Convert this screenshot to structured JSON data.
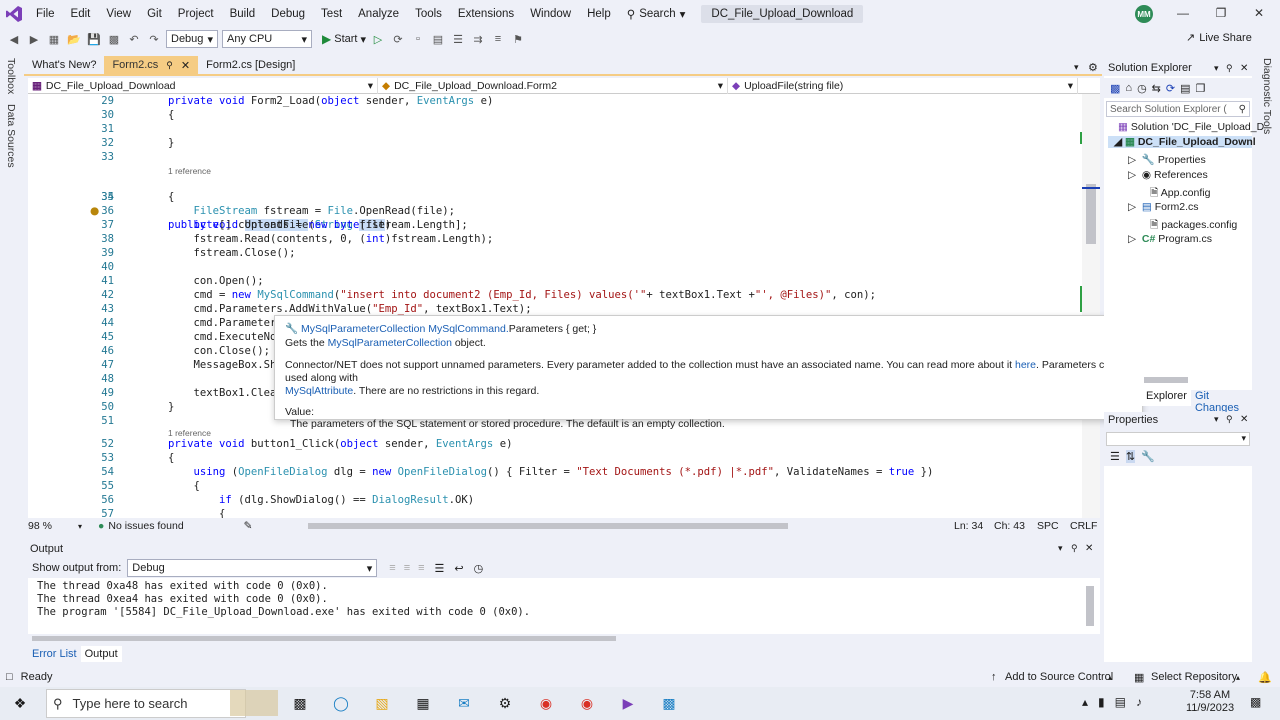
{
  "menu": [
    "File",
    "Edit",
    "View",
    "Git",
    "Project",
    "Build",
    "Debug",
    "Test",
    "Analyze",
    "Tools",
    "Extensions",
    "Window",
    "Help"
  ],
  "search_label": "Search",
  "solution_title": "DC_File_Upload_Download",
  "avatar_initials": "MM",
  "toolbar": {
    "config": "Debug",
    "platform": "Any CPU",
    "start": "Start",
    "live_share": "Live Share"
  },
  "left_strip": {
    "toolbox": "Toolbox",
    "data_sources": "Data Sources"
  },
  "right_strip": {
    "diagnostic": "Diagnostic Tools"
  },
  "tabs": [
    {
      "label": "What's New?"
    },
    {
      "label": "Form2.cs"
    },
    {
      "label": "Form2.cs [Design]"
    }
  ],
  "navbar": {
    "project": "DC_File_Upload_Download",
    "class": "DC_File_Upload_Download.Form2",
    "member": "UploadFile(string file)"
  },
  "code": [
    {
      "n": "29",
      "t": "private void Form2_Load(object sender, EventArgs e)"
    },
    {
      "n": "30",
      "t": "{"
    },
    {
      "n": "31",
      "t": ""
    },
    {
      "n": "32",
      "t": "}"
    },
    {
      "n": "33",
      "t": ""
    },
    {
      "ref": "1 reference"
    },
    {
      "n": "34",
      "t": "public void UploadFile(String file)"
    },
    {
      "n": "35",
      "t": "{"
    },
    {
      "n": "36",
      "t": "    FileStream fstream = File.OpenRead(file);"
    },
    {
      "n": "37",
      "t": "    byte[] contents = new byte[fstream.Length];"
    },
    {
      "n": "38",
      "t": "    fstream.Read(contents, 0, (int)fstream.Length);"
    },
    {
      "n": "39",
      "t": "    fstream.Close();"
    },
    {
      "n": "40",
      "t": ""
    },
    {
      "n": "41",
      "t": "    con.Open();"
    },
    {
      "n": "42",
      "t": "    cmd = new MySqlCommand(\"insert into document2 (Emp_Id, Files) values('\"+ textBox1.Text +\"', @Files)\", con);"
    },
    {
      "n": "43",
      "t": "    cmd.Parameters.AddWithValue(\"Emp_Id\", textBox1.Text);"
    },
    {
      "n": "44",
      "t": "    cmd.Parameter"
    },
    {
      "n": "45",
      "t": "    cmd.ExecuteNo"
    },
    {
      "n": "46",
      "t": "    con.Close();"
    },
    {
      "n": "47",
      "t": "    MessageBox.Sh"
    },
    {
      "n": "48",
      "t": ""
    },
    {
      "n": "49",
      "t": "    textBox1.Clea"
    },
    {
      "n": "50",
      "t": "}"
    },
    {
      "n": "51",
      "t": ""
    },
    {
      "ref": "1 reference"
    },
    {
      "n": "52",
      "t": "private void button1_Click(object sender, EventArgs e)"
    },
    {
      "n": "53",
      "t": "{"
    },
    {
      "n": "54",
      "t": "    using (OpenFileDialog dlg = new OpenFileDialog() { Filter = \"Text Documents (*.pdf) |*.pdf\", ValidateNames = true })"
    },
    {
      "n": "55",
      "t": "    {"
    },
    {
      "n": "56",
      "t": "        if (dlg.ShowDialog() == DialogResult.OK)"
    },
    {
      "n": "57",
      "t": "        {"
    }
  ],
  "tooltip": {
    "signature_prefix": "MySqlParameterCollection MySqlCommand.",
    "signature_member": "Parameters",
    "signature_suffix": " { get; }",
    "summary_prefix": "Gets the ",
    "summary_link": "MySqlParameterCollection",
    "summary_suffix": " object.",
    "remarks_1": "Connector/NET does not support unnamed parameters. Every parameter added to the collection must have an associated name. You can read more about it ",
    "remarks_link": "here",
    "remarks_2": ". Parameters can be used along with",
    "remarks_link2": "MySqlAttribute",
    "remarks_3": ". There are no restrictions in this regard.",
    "value_label": "Value:",
    "value_text": "The parameters of the SQL statement or stored procedure. The default is an empty collection."
  },
  "editor_status": {
    "zoom": "98 %",
    "issues": "No issues found",
    "ln": "Ln: 34",
    "ch": "Ch: 43",
    "spc": "SPC",
    "crlf": "CRLF"
  },
  "solution_explorer": {
    "title": "Solution Explorer",
    "search_placeholder": "Search Solution Explorer (",
    "items": [
      {
        "label": "Solution 'DC_File_Upload_D"
      },
      {
        "label": "DC_File_Upload_Downl"
      },
      {
        "label": "Properties"
      },
      {
        "label": "References"
      },
      {
        "label": "App.config"
      },
      {
        "label": "Form2.cs"
      },
      {
        "label": "packages.config"
      },
      {
        "label": "Program.cs"
      }
    ],
    "bottom_tabs": [
      "Explorer",
      "Git Changes"
    ]
  },
  "properties_title": "Properties",
  "output": {
    "title": "Output",
    "show_from_label": "Show output from:",
    "show_from_value": "Debug",
    "lines": [
      "The thread 0xa48 has exited with code 0 (0x0).",
      "The thread 0xea4 has exited with code 0 (0x0).",
      "The program '[5584] DC_File_Upload_Download.exe' has exited with code 0 (0x0)."
    ]
  },
  "bottom_tabs": [
    "Error List",
    "Output"
  ],
  "statusbar": {
    "ready": "Ready",
    "source_control": "Add to Source Control",
    "repo": "Select Repository"
  },
  "taskbar": {
    "search": "Type here to search",
    "time": "7:58 AM",
    "date": "11/9/2023"
  }
}
